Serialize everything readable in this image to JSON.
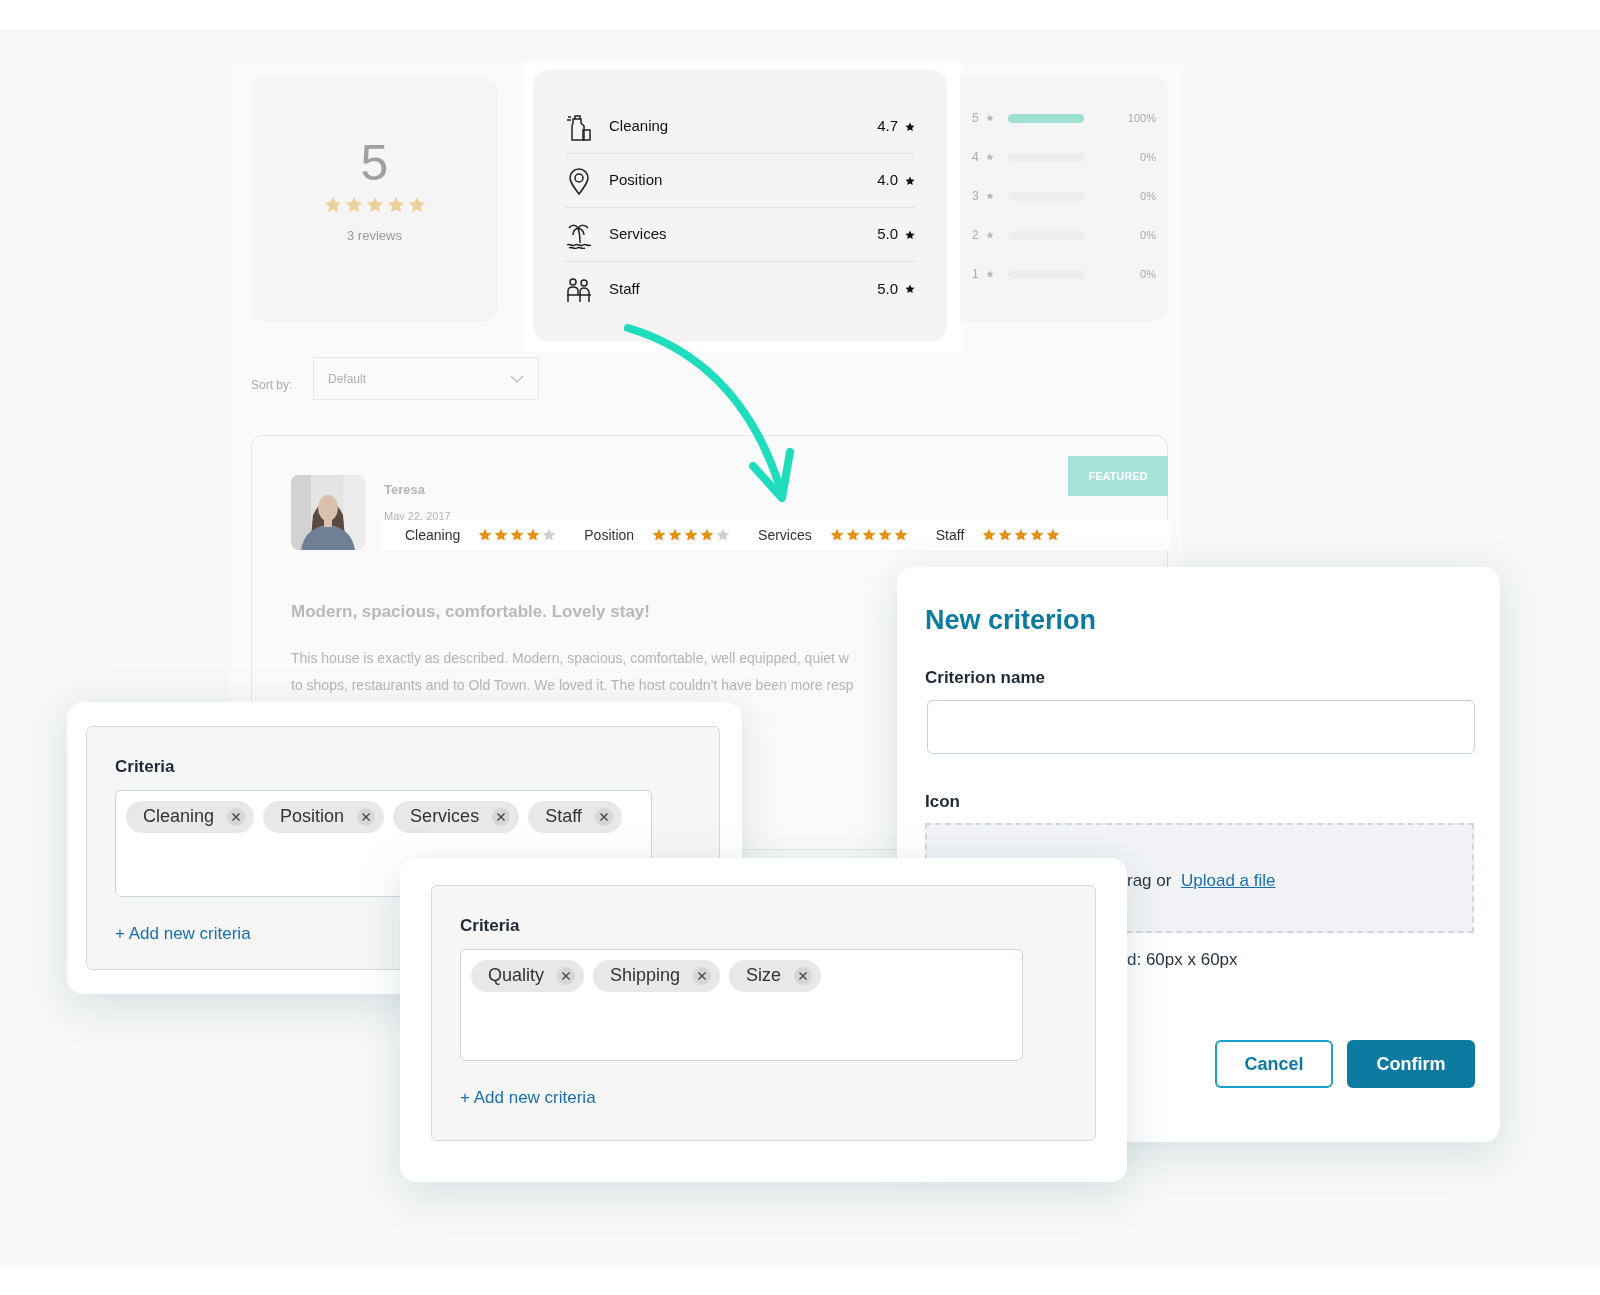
{
  "summary": {
    "score": "5",
    "stars": 5,
    "reviews": "3 reviews"
  },
  "criteria_scores": [
    {
      "label": "Cleaning",
      "value": "4.7"
    },
    {
      "label": "Position",
      "value": "4.0"
    },
    {
      "label": "Services",
      "value": "5.0"
    },
    {
      "label": "Staff",
      "value": "5.0"
    }
  ],
  "histogram": [
    {
      "label": "5",
      "level": 1,
      "percent": "100%"
    },
    {
      "label": "4",
      "level": 0,
      "percent": "0%"
    },
    {
      "label": "3",
      "level": 0,
      "percent": "0%"
    },
    {
      "label": "2",
      "level": 0,
      "percent": "0%"
    },
    {
      "label": "1",
      "level": 0,
      "percent": "0%"
    }
  ],
  "sort": {
    "label": "Sort by:",
    "value": "Default"
  },
  "review": {
    "author": "Teresa",
    "date": "May 22, 2017",
    "badge": "FEATURED",
    "ratings": [
      {
        "label": "Cleaning",
        "stars": 4
      },
      {
        "label": "Position",
        "stars": 4
      },
      {
        "label": "Services",
        "stars": 5
      },
      {
        "label": "Staff",
        "stars": 5
      }
    ],
    "title": "Modern, spacious, comfortable. Lovely stay!",
    "body_lines": [
      "This house is exactly as described. Modern, spacious, comfortable, well equipped, quiet w",
      "to shops, restaurants and to Old Town. We loved it. The host couldn’t have been more resp"
    ]
  },
  "modal": {
    "title": "New criterion",
    "name_label": "Criterion name",
    "icon_label": "Icon",
    "drop_text": "rag or",
    "upload_link": "Upload a file",
    "hint": "d: 60px x 60px",
    "buttons": [
      {
        "label": "Cancel",
        "kind": "secondary"
      },
      {
        "label": "Confirm",
        "kind": "primary"
      }
    ]
  },
  "criteria_panels": [
    {
      "label": "Criteria",
      "tags": [
        "Cleaning",
        "Position",
        "Services",
        "Staff"
      ],
      "add_link": "+ Add new criteria"
    },
    {
      "label": "Criteria",
      "tags": [
        "Quality",
        "Shipping",
        "Size"
      ],
      "add_link": "+ Add new criteria"
    }
  ]
}
